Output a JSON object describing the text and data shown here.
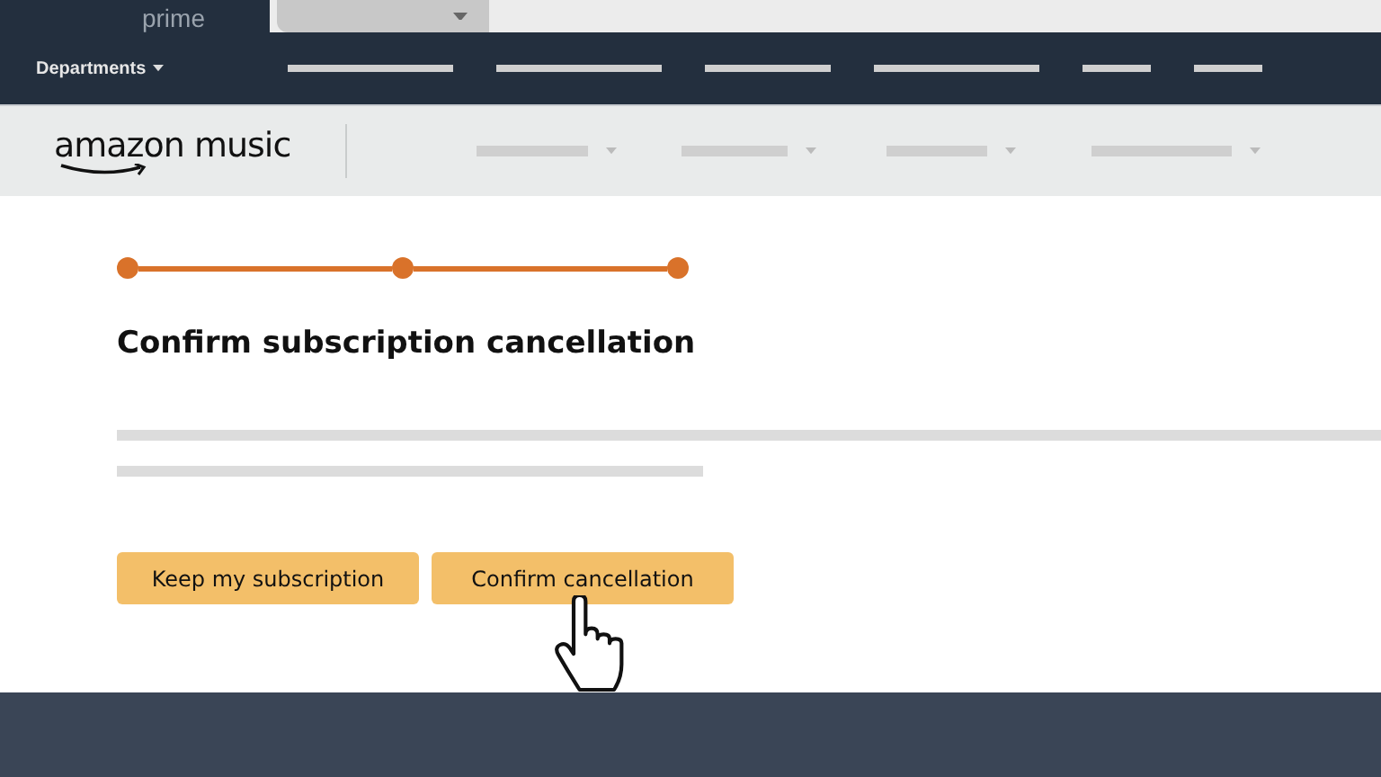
{
  "header": {
    "logo_sub": "prime",
    "departments": "Departments"
  },
  "subheader": {
    "logo": "amazon music"
  },
  "steps": [
    {
      "done": true
    },
    {
      "done": true
    },
    {
      "done": true
    }
  ],
  "title": "Confirm subscription cancellation",
  "buttons": [
    {
      "label": "Keep my subscription"
    },
    {
      "label": "Confirm cancellation"
    }
  ]
}
